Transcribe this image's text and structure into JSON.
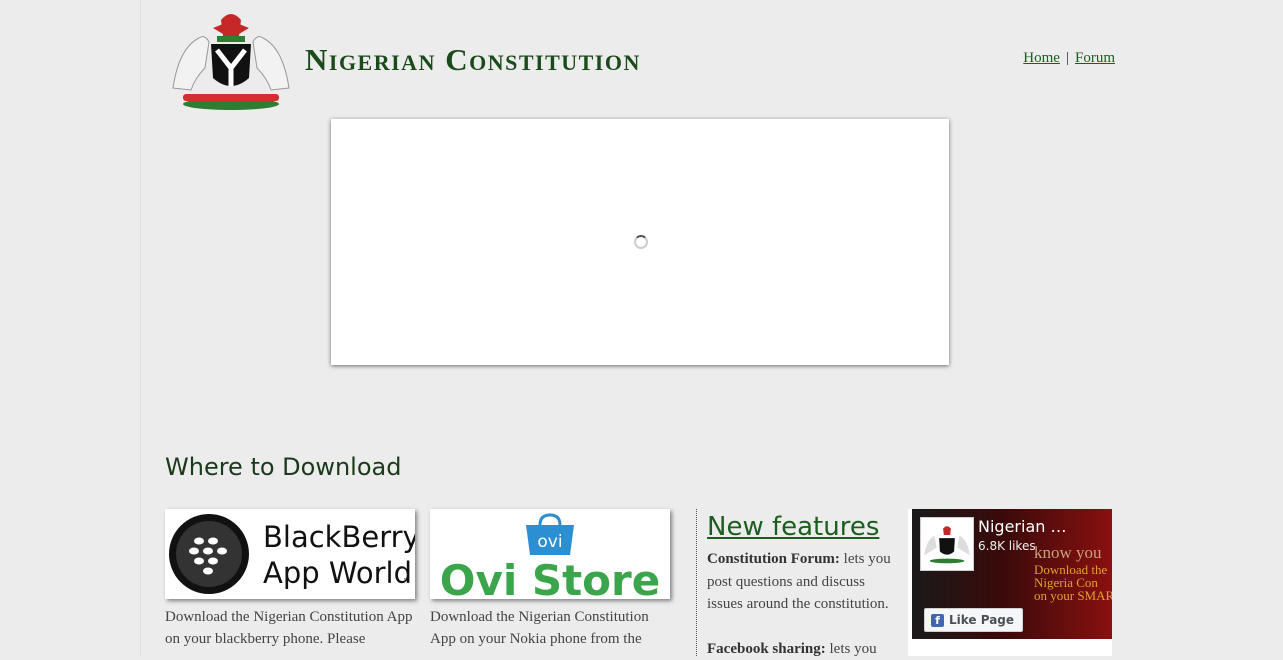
{
  "header": {
    "site_title": "Nigerian Constitution",
    "nav": [
      {
        "label": "Home"
      },
      {
        "label": "Forum"
      }
    ],
    "nav_separator": "|"
  },
  "downloads": {
    "section_title": "Where to Download",
    "blackberry": {
      "logo_text_line1": "BlackBerry",
      "logo_text_line2": "App World",
      "tm": "™",
      "description": "Download the Nigerian Constitution App on your blackberry phone. Please"
    },
    "ovi": {
      "badge": "ovi",
      "logo_text": "Ovi Store",
      "description": "Download the Nigerian Constitution App on your Nokia phone from the"
    }
  },
  "new_features": {
    "title": "New features",
    "items": [
      {
        "name": "Constitution Forum:",
        "text": " lets you post questions and discuss issues around the constitution."
      },
      {
        "name": "Facebook sharing:",
        "text": " lets you"
      }
    ]
  },
  "facebook": {
    "page_name": "Nigerian …",
    "likes": "6.8K likes",
    "promo_line1": "know you",
    "promo_line2": "Download the",
    "promo_line3": "Nigeria Con",
    "promo_line4": "on your SMAR",
    "like_button": "Like Page"
  },
  "colors": {
    "brand_green": "#1b4a1b",
    "link_green": "#1b5e20",
    "page_bg": "#ececec"
  }
}
